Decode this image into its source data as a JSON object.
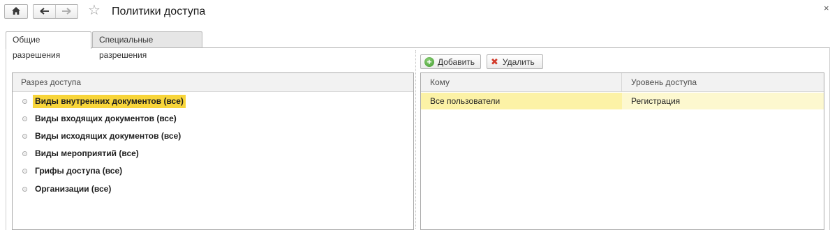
{
  "header": {
    "title": "Политики доступа",
    "home_icon": "home-icon",
    "back_icon": "arrow-left-icon",
    "forward_icon": "arrow-right-icon",
    "favorite_icon": "star-icon",
    "close_symbol": "×"
  },
  "tabs": [
    {
      "label": "Общие разрешения",
      "active": true
    },
    {
      "label": "Специальные разрешения",
      "active": false
    }
  ],
  "toolbar": {
    "add_label": "Добавить",
    "delete_label": "Удалить"
  },
  "tree": {
    "header": "Разрез доступа",
    "items": [
      {
        "label": "Виды внутренних документов (все)",
        "selected": true
      },
      {
        "label": "Виды входящих документов (все)",
        "selected": false
      },
      {
        "label": "Виды исходящих документов (все)",
        "selected": false
      },
      {
        "label": "Виды мероприятий (все)",
        "selected": false
      },
      {
        "label": "Грифы доступа (все)",
        "selected": false
      },
      {
        "label": "Организации (все)",
        "selected": false
      }
    ]
  },
  "table": {
    "columns": [
      "Кому",
      "Уровень доступа"
    ],
    "rows": [
      {
        "to": "Все пользователи",
        "level": "Регистрация"
      }
    ]
  },
  "colors": {
    "selection": "#f8d53a",
    "row_highlight": "#fcf2a6",
    "add_icon": "#3f9b2c",
    "delete_icon": "#d23a2a"
  }
}
